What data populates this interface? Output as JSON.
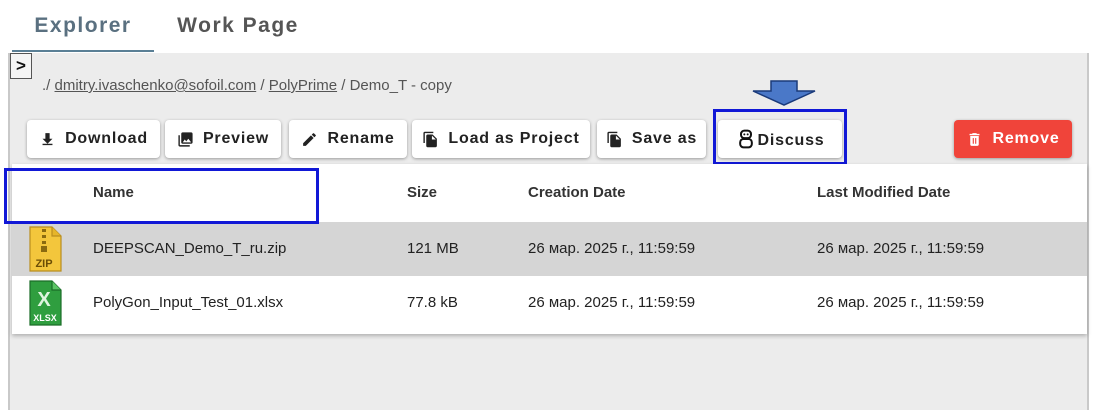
{
  "tabs": [
    {
      "label": "Explorer",
      "active": true
    },
    {
      "label": "Work Page",
      "active": false
    }
  ],
  "sidebar_toggle": {
    "glyph": ">"
  },
  "breadcrumb": {
    "prefix": "./",
    "parts": [
      "dmitry.ivaschenko@sofoil.com",
      "PolyPrime",
      "Demo_T - copy"
    ],
    "separator": "/"
  },
  "toolbar": {
    "download": "Download",
    "preview": "Preview",
    "rename": "Rename",
    "load_as_project": "Load as Project",
    "save_as": "Save as",
    "discuss": "Discuss",
    "remove": "Remove"
  },
  "table": {
    "headers": [
      "Name",
      "Size",
      "Creation Date",
      "Last Modified Date"
    ],
    "rows": [
      {
        "icon": "zip-file-icon",
        "icon_label": "ZIP",
        "name": "DEEPSCAN_Demo_T_ru.zip",
        "size": "121 MB",
        "created": "26 мар. 2025 г., 11:59:59",
        "modified": "26 мар. 2025 г., 11:59:59",
        "selected": true
      },
      {
        "icon": "xlsx-file-icon",
        "icon_label": "XLSX",
        "name": "PolyGon_Input_Test_01.xlsx",
        "size": "77.8 kB",
        "created": "26 мар. 2025 г., 11:59:59",
        "modified": "26 мар. 2025 г., 11:59:59",
        "selected": false
      }
    ]
  },
  "colors": {
    "accent_tab": "#5a7f95",
    "remove_button": "#f0443a",
    "highlight": "#1118d6",
    "arrow": "#4a78c8",
    "selected_row": "#d5d5d5"
  }
}
